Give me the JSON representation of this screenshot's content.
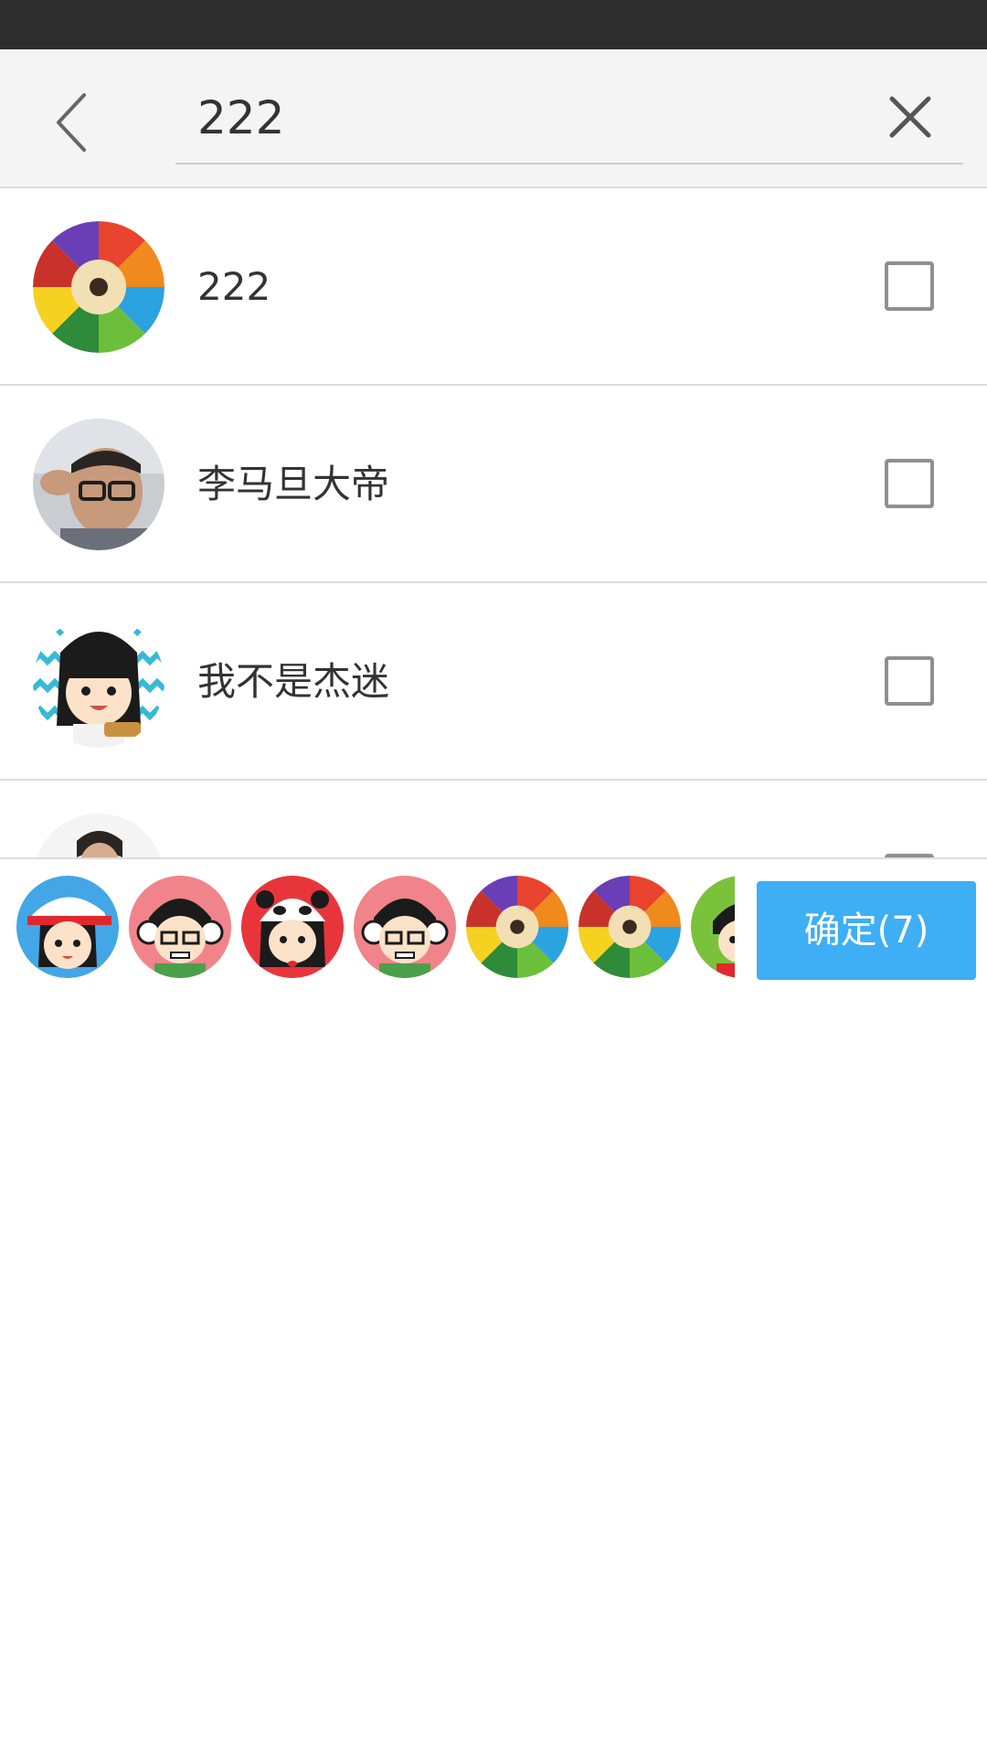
{
  "search": {
    "value": "222",
    "back_icon": "chevron-left-icon",
    "clear_icon": "close-icon"
  },
  "results": [
    {
      "name": "222",
      "avatar": "color-pencils",
      "checked": false
    },
    {
      "name": "李马旦大帝",
      "avatar": "man-glasses-photo",
      "checked": false
    },
    {
      "name": "我不是杰迷",
      "avatar": "cartoon-girl-guitar",
      "checked": false
    },
    {
      "name": "",
      "avatar": "man-portrait-photo",
      "checked": false
    }
  ],
  "selected": {
    "avatars": [
      "cartoon-girl-cap",
      "cartoon-boy-headphones",
      "cartoon-girl-panda-hat",
      "cartoon-boy-headphones",
      "color-pencils",
      "color-pencils",
      "cartoon-boy-green"
    ],
    "confirm_label": "确定(7)"
  },
  "colors": {
    "accent": "#3eaef5",
    "status_bar": "#2d2d2d",
    "header_bg": "#f4f4f4",
    "divider": "#dcdcdc"
  }
}
